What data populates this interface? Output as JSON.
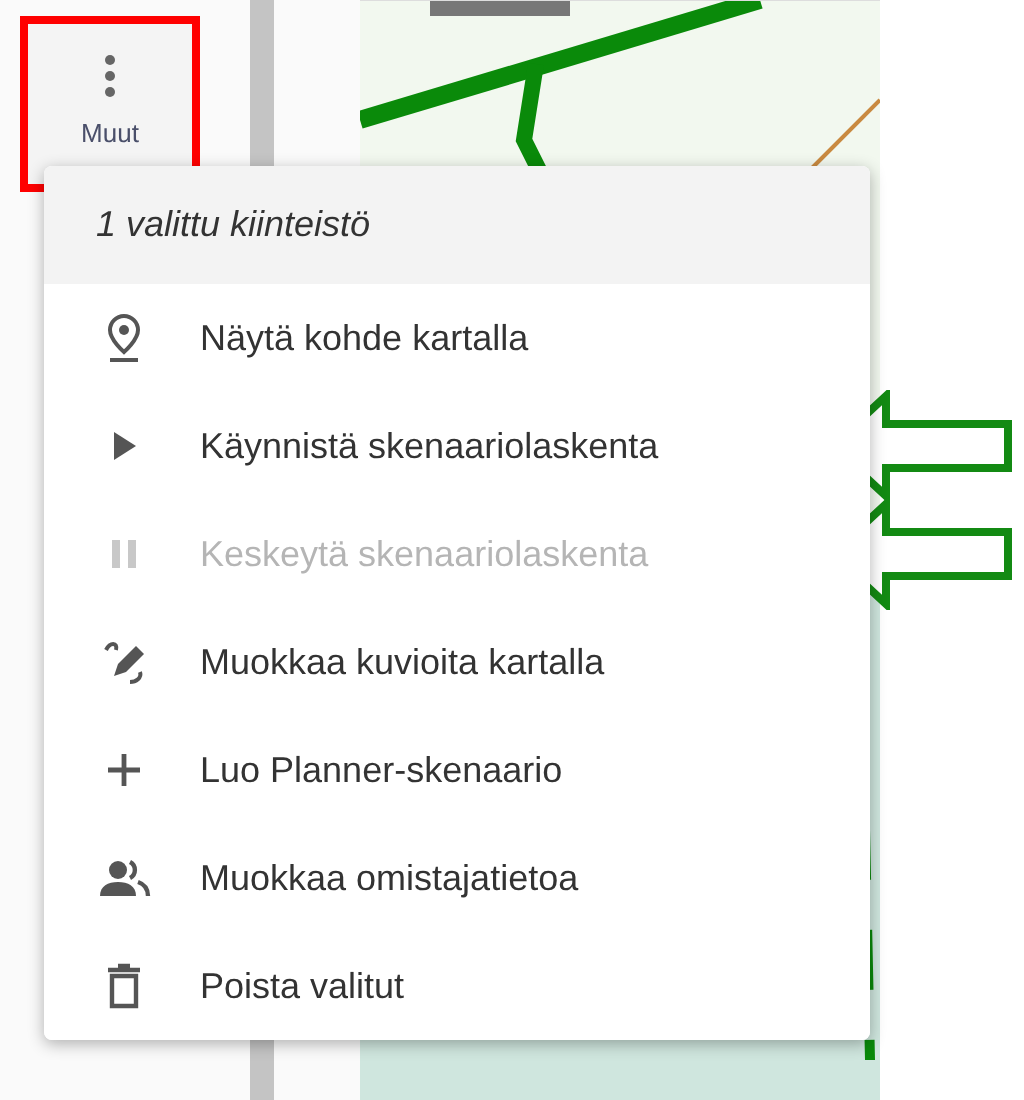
{
  "toolbar_button": {
    "label": "Muut",
    "highlighted": true
  },
  "menu": {
    "header": "1 valittu kiinteistö",
    "items": [
      {
        "kind": "pin",
        "label": "Näytä kohde kartalla",
        "disabled": false,
        "marked": false
      },
      {
        "kind": "play",
        "label": "Käynnistä skenaariolaskenta",
        "disabled": false,
        "marked": true
      },
      {
        "kind": "pause",
        "label": "Keskeytä skenaariolaskenta",
        "disabled": true,
        "marked": true
      },
      {
        "kind": "draw",
        "label": "Muokkaa kuvioita kartalla",
        "disabled": false,
        "marked": false
      },
      {
        "kind": "add",
        "label": "Luo Planner-skenaario",
        "disabled": false,
        "marked": false
      },
      {
        "kind": "people",
        "label": "Muokkaa omistajatietoa",
        "disabled": false,
        "marked": false
      },
      {
        "kind": "delete",
        "label": "Poista valitut",
        "disabled": false,
        "marked": false
      }
    ]
  }
}
